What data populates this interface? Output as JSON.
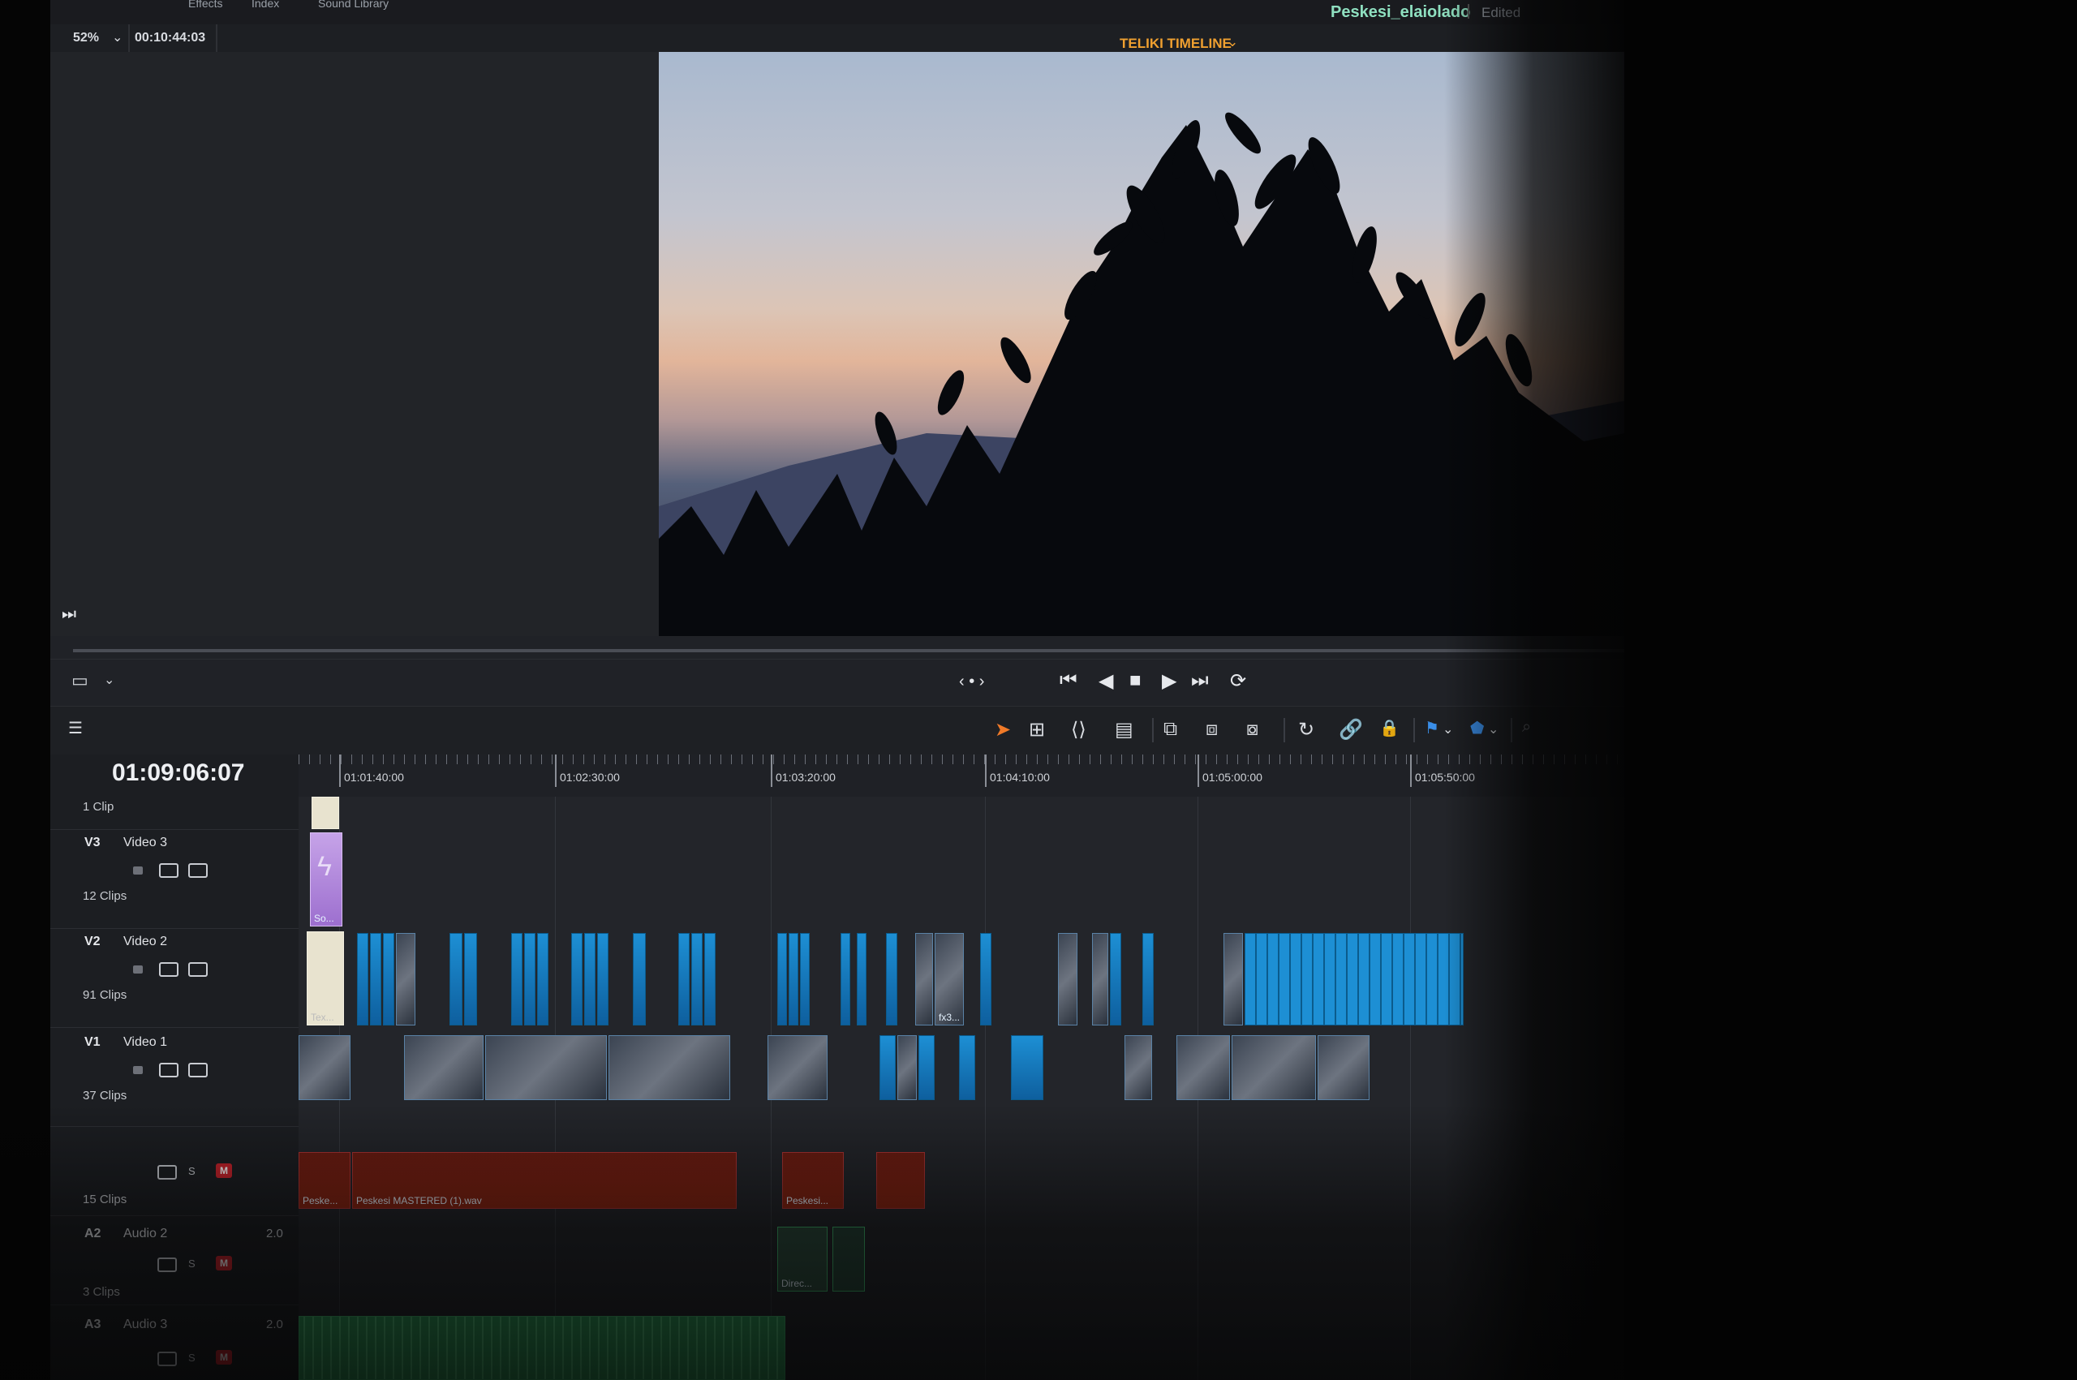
{
  "window": {
    "project_name": "Peskesi_elaiolado",
    "status": "Edited",
    "page_tabs": [
      "Effects",
      "Index",
      "Sound Library"
    ]
  },
  "viewer": {
    "zoom": "52%",
    "source_timecode": "00:10:44:03",
    "timeline_name": "TELIKI TIMELINE"
  },
  "timeline": {
    "current_timecode": "01:09:06:07",
    "ruler_labels": [
      "01:01:40:00",
      "01:02:30:00",
      "01:03:20:00",
      "01:04:10:00",
      "01:05:00:00",
      "01:05:50:00"
    ],
    "tracks": {
      "top_clips": "1 Clip",
      "v3": {
        "id": "V3",
        "name": "Video 3",
        "clips": "12 Clips"
      },
      "v2": {
        "id": "V2",
        "name": "Video 2",
        "clips": "91 Clips"
      },
      "v1": {
        "id": "V1",
        "name": "Video 1",
        "clips": "37 Clips"
      },
      "a1": {
        "clips": "15 Clips"
      },
      "a2": {
        "id": "A2",
        "name": "Audio 2",
        "channel": "2.0",
        "clips": "3 Clips"
      },
      "a3": {
        "id": "A3",
        "name": "Audio 3",
        "channel": "2.0"
      }
    },
    "clip_labels": {
      "fx_clip": "fx3...",
      "text_clip": "Tex...",
      "so_clip": "So...",
      "audio_main": "Peskesi MASTERED (1).wav",
      "audio_left": "Peske...",
      "audio_mid": "Peskesi...",
      "audio_a2": "Direc..."
    },
    "solo_label": "S",
    "mute_label": "M"
  },
  "colors": {
    "accent_orange": "#f0a030",
    "clip_blue": "#1d8fd4",
    "audio_red": "#8a2412",
    "audio_green": "#2e9a58",
    "project_name": "#8fe0c0"
  }
}
